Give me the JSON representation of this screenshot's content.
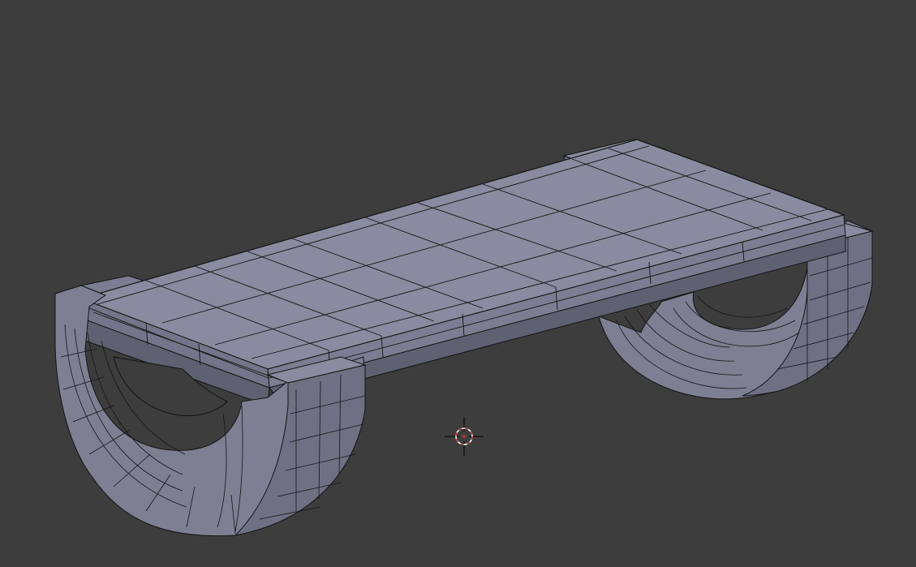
{
  "viewport": {
    "background": "#3d3d3d",
    "shading": "solid-wireframe",
    "object": {
      "name_shown": false,
      "kind": "bench-mesh",
      "colors": {
        "top_face": "#8a8ba0",
        "side_face": "#7c7d92",
        "shadow_face": "#5f6072",
        "rocker_face": "#7e7f93",
        "rocker_dark": "#6a6b7d",
        "edge": "#141414"
      }
    },
    "cursor": {
      "icon": "3d-cursor-icon",
      "ring_color": "#c0392b",
      "ring_alt_color": "#ffffff",
      "crosshair_color": "#000000"
    }
  }
}
